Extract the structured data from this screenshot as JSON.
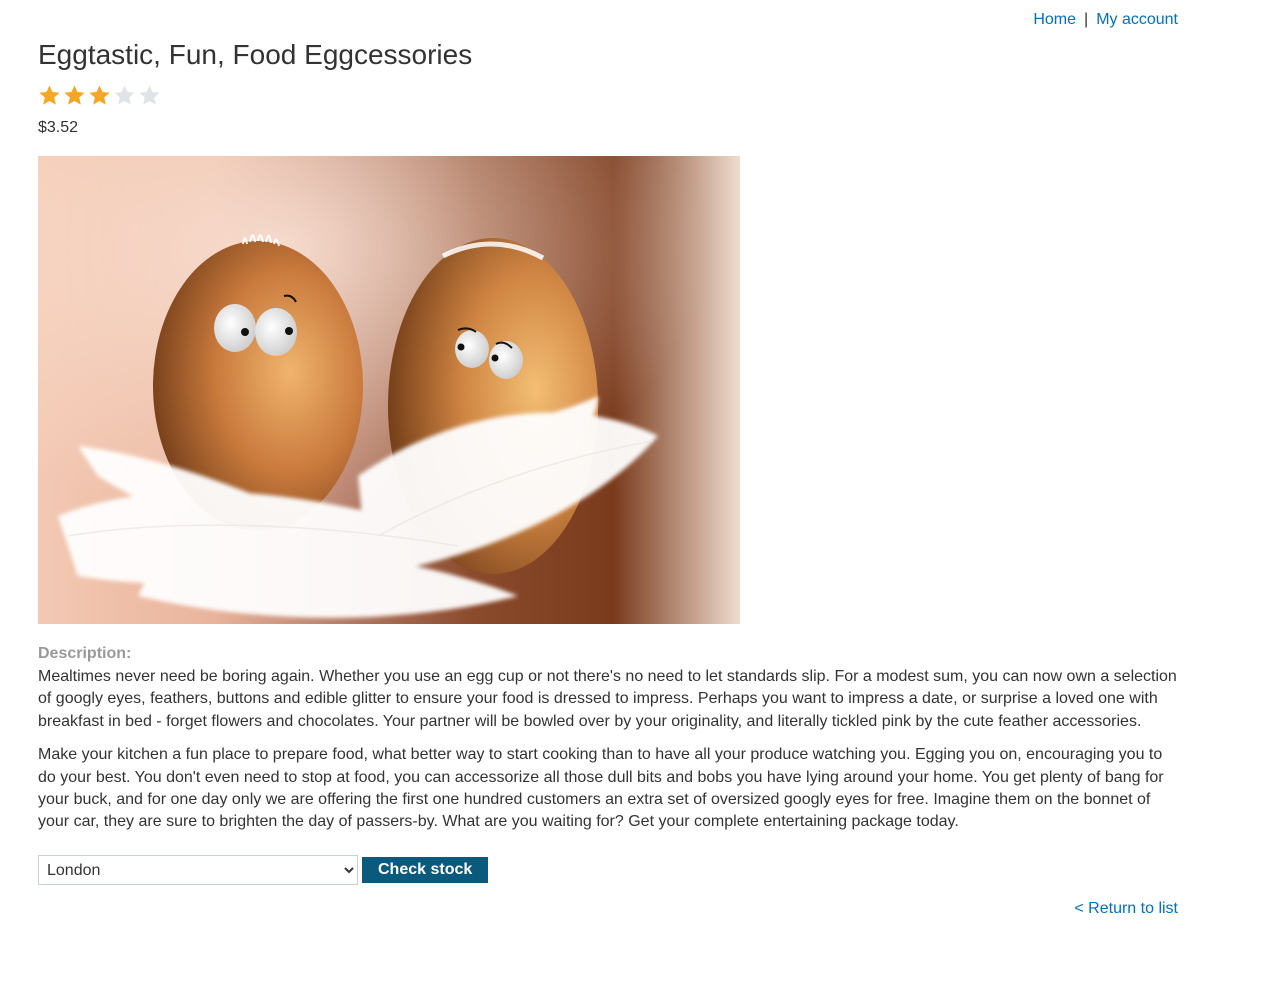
{
  "nav": {
    "home_label": "Home",
    "separator": "|",
    "account_label": "My account"
  },
  "product": {
    "title": "Eggtastic, Fun, Food Eggcessories",
    "rating": 3,
    "rating_max": 5,
    "price": "$3.52",
    "description_label": "Description:",
    "description_paragraphs": [
      "Mealtimes never need be boring again. Whether you use an egg cup or not there's no need to let standards slip. For a modest sum, you can now own a selection of googly eyes, feathers, buttons and edible glitter to ensure your food is dressed to impress. Perhaps you want to impress a date, or surprise a loved one with breakfast in bed - forget flowers and chocolates. Your partner will be bowled over by your originality, and literally tickled pink by the cute feather accessories.",
      "Make your kitchen a fun place to prepare food, what better way to start cooking than to have all your produce watching you. Egging you on, encouraging you to do your best. You don't even need to stop at food, you can accessorize all those dull bits and bobs you have lying around your home. You get plenty of bang for your buck, and for one day only we are offering the first one hundred customers an extra set of oversized googly eyes for free. Imagine them on the bonnet of your car, they are sure to brighten the day of passers-by. What are you waiting for? Get your complete entertaining package today."
    ]
  },
  "stock": {
    "selected_location": "London",
    "check_button_label": "Check stock"
  },
  "footer": {
    "return_label": "< Return to list"
  },
  "colors": {
    "link": "#0071bc",
    "star_filled": "#f5a623",
    "star_empty": "#e0e4e6",
    "button_bg": "#0a5a7e"
  },
  "icons": {
    "star": "star-icon",
    "dropdown": "chevron-down-icon"
  }
}
